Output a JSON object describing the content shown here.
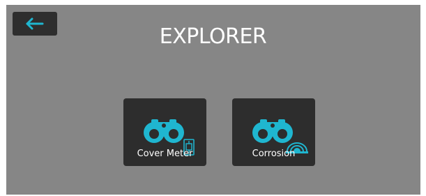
{
  "app": {
    "title": "EXPLORER",
    "accent_color": "#1fb6d0",
    "background_color": "#868686",
    "tile_color": "#2d2d2d"
  },
  "header": {
    "back_button": {
      "icon": "arrow-left-icon"
    }
  },
  "modules": [
    {
      "label": "Cover Meter",
      "icon": "binoculars-icon",
      "badge_icon": "cover-meter-probe-icon"
    },
    {
      "label": "Corrosion",
      "icon": "binoculars-icon",
      "badge_icon": "corrosion-probe-icon"
    }
  ]
}
